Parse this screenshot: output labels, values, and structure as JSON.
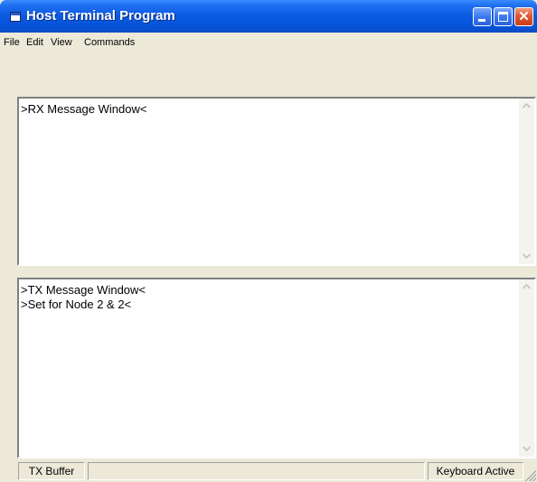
{
  "window": {
    "title": "Host Terminal Program"
  },
  "menu": {
    "items": [
      "File",
      "Edit",
      "View",
      "Commands"
    ]
  },
  "rx": {
    "lines": [
      ">RX Message Window<"
    ]
  },
  "tx": {
    "lines": [
      ">TX Message Window<",
      ">Set for Node 2 & 2<"
    ]
  },
  "status": {
    "left": "TX Buffer",
    "middle": "",
    "right": "Keyboard Active"
  }
}
